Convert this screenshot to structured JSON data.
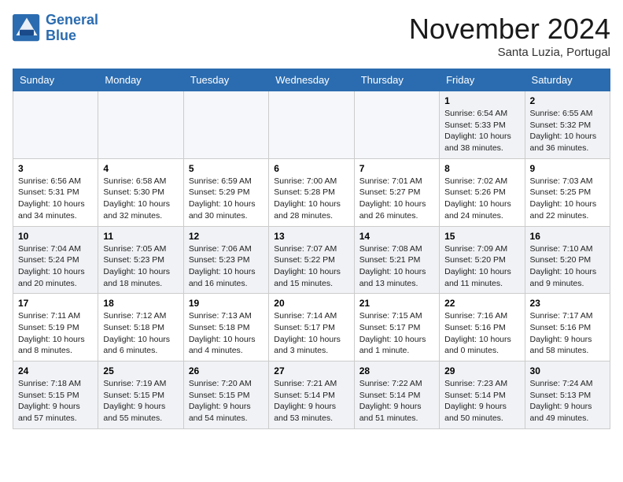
{
  "header": {
    "logo_line1": "General",
    "logo_line2": "Blue",
    "month": "November 2024",
    "location": "Santa Luzia, Portugal"
  },
  "columns": [
    "Sunday",
    "Monday",
    "Tuesday",
    "Wednesday",
    "Thursday",
    "Friday",
    "Saturday"
  ],
  "rows": [
    [
      {
        "day": "",
        "info": ""
      },
      {
        "day": "",
        "info": ""
      },
      {
        "day": "",
        "info": ""
      },
      {
        "day": "",
        "info": ""
      },
      {
        "day": "",
        "info": ""
      },
      {
        "day": "1",
        "info": "Sunrise: 6:54 AM\nSunset: 5:33 PM\nDaylight: 10 hours and 38 minutes."
      },
      {
        "day": "2",
        "info": "Sunrise: 6:55 AM\nSunset: 5:32 PM\nDaylight: 10 hours and 36 minutes."
      }
    ],
    [
      {
        "day": "3",
        "info": "Sunrise: 6:56 AM\nSunset: 5:31 PM\nDaylight: 10 hours and 34 minutes."
      },
      {
        "day": "4",
        "info": "Sunrise: 6:58 AM\nSunset: 5:30 PM\nDaylight: 10 hours and 32 minutes."
      },
      {
        "day": "5",
        "info": "Sunrise: 6:59 AM\nSunset: 5:29 PM\nDaylight: 10 hours and 30 minutes."
      },
      {
        "day": "6",
        "info": "Sunrise: 7:00 AM\nSunset: 5:28 PM\nDaylight: 10 hours and 28 minutes."
      },
      {
        "day": "7",
        "info": "Sunrise: 7:01 AM\nSunset: 5:27 PM\nDaylight: 10 hours and 26 minutes."
      },
      {
        "day": "8",
        "info": "Sunrise: 7:02 AM\nSunset: 5:26 PM\nDaylight: 10 hours and 24 minutes."
      },
      {
        "day": "9",
        "info": "Sunrise: 7:03 AM\nSunset: 5:25 PM\nDaylight: 10 hours and 22 minutes."
      }
    ],
    [
      {
        "day": "10",
        "info": "Sunrise: 7:04 AM\nSunset: 5:24 PM\nDaylight: 10 hours and 20 minutes."
      },
      {
        "day": "11",
        "info": "Sunrise: 7:05 AM\nSunset: 5:23 PM\nDaylight: 10 hours and 18 minutes."
      },
      {
        "day": "12",
        "info": "Sunrise: 7:06 AM\nSunset: 5:23 PM\nDaylight: 10 hours and 16 minutes."
      },
      {
        "day": "13",
        "info": "Sunrise: 7:07 AM\nSunset: 5:22 PM\nDaylight: 10 hours and 15 minutes."
      },
      {
        "day": "14",
        "info": "Sunrise: 7:08 AM\nSunset: 5:21 PM\nDaylight: 10 hours and 13 minutes."
      },
      {
        "day": "15",
        "info": "Sunrise: 7:09 AM\nSunset: 5:20 PM\nDaylight: 10 hours and 11 minutes."
      },
      {
        "day": "16",
        "info": "Sunrise: 7:10 AM\nSunset: 5:20 PM\nDaylight: 10 hours and 9 minutes."
      }
    ],
    [
      {
        "day": "17",
        "info": "Sunrise: 7:11 AM\nSunset: 5:19 PM\nDaylight: 10 hours and 8 minutes."
      },
      {
        "day": "18",
        "info": "Sunrise: 7:12 AM\nSunset: 5:18 PM\nDaylight: 10 hours and 6 minutes."
      },
      {
        "day": "19",
        "info": "Sunrise: 7:13 AM\nSunset: 5:18 PM\nDaylight: 10 hours and 4 minutes."
      },
      {
        "day": "20",
        "info": "Sunrise: 7:14 AM\nSunset: 5:17 PM\nDaylight: 10 hours and 3 minutes."
      },
      {
        "day": "21",
        "info": "Sunrise: 7:15 AM\nSunset: 5:17 PM\nDaylight: 10 hours and 1 minute."
      },
      {
        "day": "22",
        "info": "Sunrise: 7:16 AM\nSunset: 5:16 PM\nDaylight: 10 hours and 0 minutes."
      },
      {
        "day": "23",
        "info": "Sunrise: 7:17 AM\nSunset: 5:16 PM\nDaylight: 9 hours and 58 minutes."
      }
    ],
    [
      {
        "day": "24",
        "info": "Sunrise: 7:18 AM\nSunset: 5:15 PM\nDaylight: 9 hours and 57 minutes."
      },
      {
        "day": "25",
        "info": "Sunrise: 7:19 AM\nSunset: 5:15 PM\nDaylight: 9 hours and 55 minutes."
      },
      {
        "day": "26",
        "info": "Sunrise: 7:20 AM\nSunset: 5:15 PM\nDaylight: 9 hours and 54 minutes."
      },
      {
        "day": "27",
        "info": "Sunrise: 7:21 AM\nSunset: 5:14 PM\nDaylight: 9 hours and 53 minutes."
      },
      {
        "day": "28",
        "info": "Sunrise: 7:22 AM\nSunset: 5:14 PM\nDaylight: 9 hours and 51 minutes."
      },
      {
        "day": "29",
        "info": "Sunrise: 7:23 AM\nSunset: 5:14 PM\nDaylight: 9 hours and 50 minutes."
      },
      {
        "day": "30",
        "info": "Sunrise: 7:24 AM\nSunset: 5:13 PM\nDaylight: 9 hours and 49 minutes."
      }
    ]
  ]
}
